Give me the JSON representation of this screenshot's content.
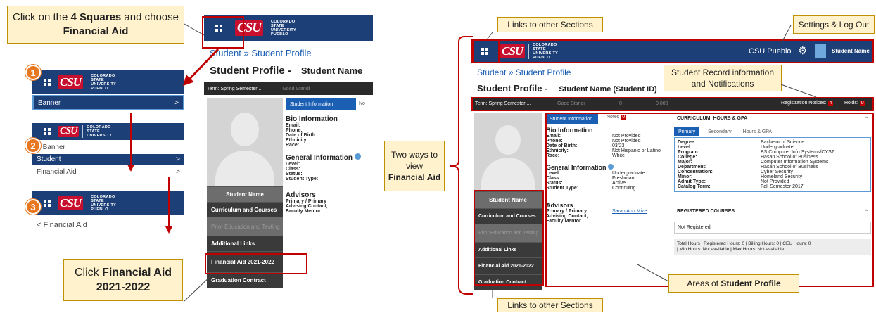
{
  "instructions": {
    "step1_pre": "Click on the ",
    "step1_bold1": "4 Squares",
    "step1_mid": " and choose ",
    "step1_bold2": "Financial Aid",
    "step2_pre": "Click ",
    "step2_bold": "Financial Aid 2021-2022"
  },
  "steps": [
    "1",
    "2",
    "3"
  ],
  "logo": {
    "csu": "CSU",
    "sub": "PUEBLO",
    "state1": "COLORADO",
    "state2": "STATE",
    "state3": "UNIVERSITY",
    "state4": "PUEBLO"
  },
  "menu": {
    "banner": "Banner",
    "banner_back": "Banner",
    "student": "Student",
    "financial_aid": "Financial Aid",
    "financial_aid_back": "Financial Aid",
    "chevron": ">",
    "back": "<"
  },
  "profile": {
    "breadcrumb_1": "Student",
    "breadcrumb_sep": "»",
    "breadcrumb_2": "Student Profile",
    "title": "Student Profile -",
    "student_name": "Student Name",
    "student_name_id": "Student Name (Student ID)",
    "term": "Term: Spring Semester ...",
    "standing": "Good Standi",
    "standing_full": "Good Standi",
    "zero": "0",
    "gpa": "0.000",
    "reg_notices_label": "Registration Notices:",
    "reg_notices_count": "4",
    "holds_label": "Holds:",
    "holds_count": "0",
    "tab_student_info": "Student Information",
    "tab_notes": "Notes",
    "tab_notes_short": "No",
    "notes_count": "0",
    "campus": "CSU Pueblo",
    "user": "Student Name"
  },
  "bio": {
    "heading": "Bio Information",
    "labels": [
      "Email:",
      "Phone:",
      "Date of Birth:",
      "Ethnicity:",
      "Race:"
    ],
    "values": [
      "Not Provided",
      "Not Provided",
      "03/23",
      "Not Hispanic or Latino",
      "White"
    ]
  },
  "general": {
    "heading": "General Information",
    "labels": [
      "Level:",
      "Class:",
      "Status:",
      "Student Type:"
    ],
    "values": [
      "Undergraduate",
      "Freshman",
      "Active",
      "Continuing"
    ]
  },
  "advisors": {
    "heading": "Advisors",
    "label": "Primary / Primary Advising Contact, Faculty Mentor",
    "value": "Sarah Ann Mize"
  },
  "sidebar": {
    "name": "Student Name",
    "items": [
      "Curriculum and Courses",
      "Prior Education and Testing",
      "Additional Links",
      "Financial Aid 2021-2022",
      "Graduation Contract"
    ]
  },
  "curriculum": {
    "heading": "CURRICULUM, HOURS & GPA",
    "tabs": [
      "Primary",
      "Secondary",
      "Hours & GPA"
    ],
    "labels": [
      "Degree:",
      "Level:",
      "Program:",
      "College:",
      "Major:",
      "Department:",
      "Concentration:",
      "Minor:",
      "Admit Type:",
      "Catalog Term:"
    ],
    "values": [
      "Bachelor of Science",
      "Undergraduate",
      "BS Computer Info Systems/CYSZ",
      "Hasan School of Business",
      "Computer Information Systems",
      "Hasan School of Business",
      "Cyber Security",
      "Homeland Security",
      "Not Provided",
      "Fall Semester 2017"
    ]
  },
  "registered": {
    "heading": "REGISTERED COURSES",
    "status": "Not Registered",
    "line1": "Total Hours | Registered Hours: 0 | Billing Hours: 0 | CEU Hours: 0",
    "line2": "| Min Hours: Not available | Max Hours: Not available"
  },
  "annotations": {
    "links_top": "Links to other Sections",
    "links_bottom": "Links to other Sections",
    "settings": "Settings & Log Out",
    "record_info": "Student Record information and Notifications",
    "two_ways": "Two ways to view",
    "two_ways_bold": "Financial Aid",
    "areas_pre": "Areas of ",
    "areas_bold": "Student Profile"
  },
  "colors": {
    "navy": "#1c3f77",
    "red": "#c00000",
    "callout": "#fff2cc",
    "orange": "#e87722",
    "blue_tab": "#1a5fb4"
  }
}
